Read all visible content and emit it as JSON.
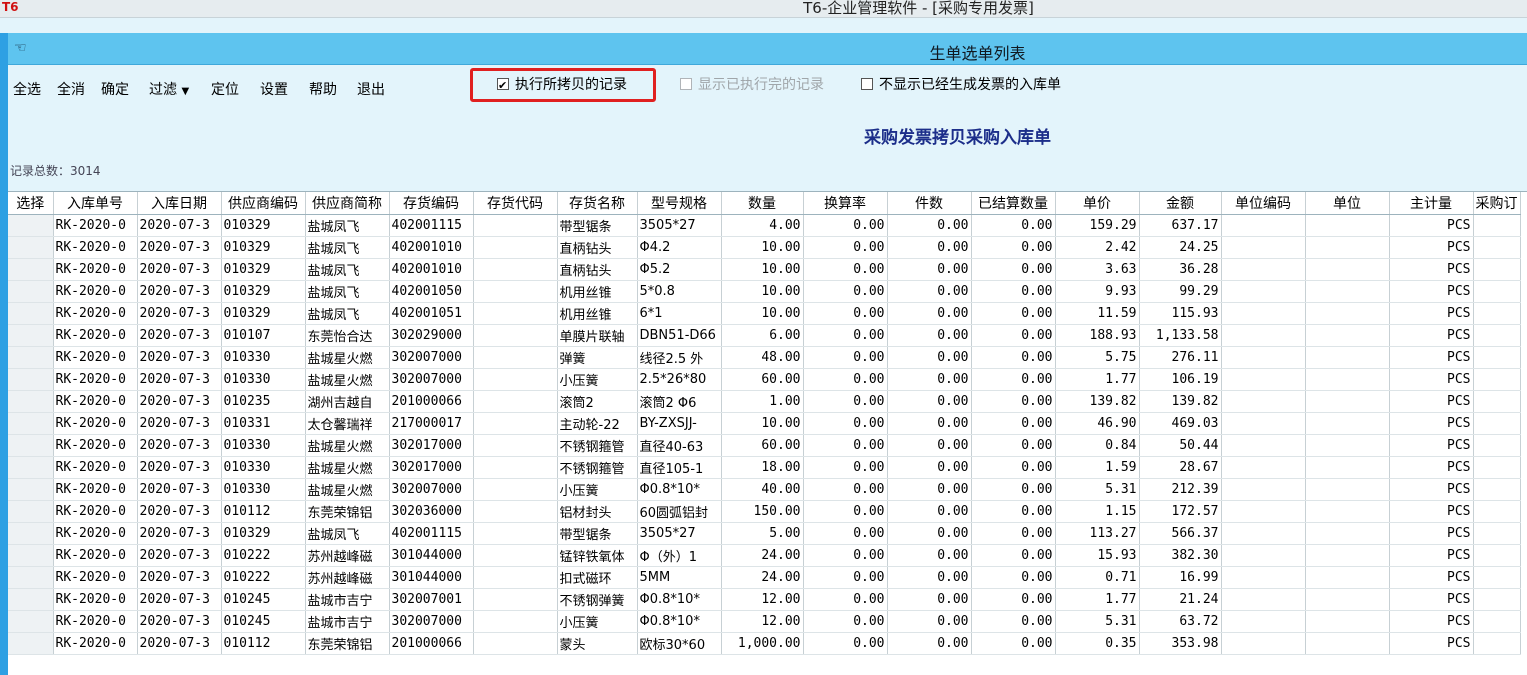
{
  "window": {
    "app_icon": "T6",
    "title": "T6-企业管理软件 - [采购专用发票]"
  },
  "subwindow": {
    "pointer_icon": "hand-pointer-icon",
    "title": "生单选单列表"
  },
  "toolbar": {
    "select_all": "全选",
    "deselect_all": "全消",
    "confirm": "确定",
    "filter": "过滤",
    "filter_arrow": "▼",
    "locate": "定位",
    "settings": "设置",
    "help": "帮助",
    "exit": "退出"
  },
  "options": {
    "exec_copied": {
      "label": "执行所拷贝的记录",
      "checked": true
    },
    "show_executed": {
      "label": "显示已执行完的记录",
      "checked": false,
      "disabled": true
    },
    "hide_invoiced": {
      "label": "不显示已经生成发票的入库单",
      "checked": false
    }
  },
  "heading": "采购发票拷贝采购入库单",
  "record_count": "记录总数：3014",
  "grid": {
    "columns": [
      "选择",
      "入库单号",
      "入库日期",
      "供应商编码",
      "供应商简称",
      "存货编码",
      "存货代码",
      "存货名称",
      "型号规格",
      "数量",
      "换算率",
      "件数",
      "已结算数量",
      "单价",
      "金额",
      "单位编码",
      "单位",
      "主计量",
      "采购订"
    ],
    "rows": [
      [
        "",
        "RK-2020-0",
        "2020-07-3",
        "010329",
        "盐城凤飞",
        "402001115",
        "",
        "带型锯条",
        "3505*27",
        "4.00",
        "0.00",
        "0.00",
        "0.00",
        "159.29",
        "637.17",
        "",
        "",
        "PCS",
        ""
      ],
      [
        "",
        "RK-2020-0",
        "2020-07-3",
        "010329",
        "盐城凤飞",
        "402001010",
        "",
        "直柄钻头",
        "Φ4.2",
        "10.00",
        "0.00",
        "0.00",
        "0.00",
        "2.42",
        "24.25",
        "",
        "",
        "PCS",
        ""
      ],
      [
        "",
        "RK-2020-0",
        "2020-07-3",
        "010329",
        "盐城凤飞",
        "402001010",
        "",
        "直柄钻头",
        "Φ5.2",
        "10.00",
        "0.00",
        "0.00",
        "0.00",
        "3.63",
        "36.28",
        "",
        "",
        "PCS",
        ""
      ],
      [
        "",
        "RK-2020-0",
        "2020-07-3",
        "010329",
        "盐城凤飞",
        "402001050",
        "",
        "机用丝锥",
        "5*0.8",
        "10.00",
        "0.00",
        "0.00",
        "0.00",
        "9.93",
        "99.29",
        "",
        "",
        "PCS",
        ""
      ],
      [
        "",
        "RK-2020-0",
        "2020-07-3",
        "010329",
        "盐城凤飞",
        "402001051",
        "",
        "机用丝锥",
        "6*1",
        "10.00",
        "0.00",
        "0.00",
        "0.00",
        "11.59",
        "115.93",
        "",
        "",
        "PCS",
        ""
      ],
      [
        "",
        "RK-2020-0",
        "2020-07-3",
        "010107",
        "东莞怡合达",
        "302029000",
        "",
        "单膜片联轴",
        "DBN51-D66",
        "6.00",
        "0.00",
        "0.00",
        "0.00",
        "188.93",
        "1,133.58",
        "",
        "",
        "PCS",
        ""
      ],
      [
        "",
        "RK-2020-0",
        "2020-07-3",
        "010330",
        "盐城星火燃",
        "302007000",
        "",
        "弹簧",
        "线径2.5 外",
        "48.00",
        "0.00",
        "0.00",
        "0.00",
        "5.75",
        "276.11",
        "",
        "",
        "PCS",
        ""
      ],
      [
        "",
        "RK-2020-0",
        "2020-07-3",
        "010330",
        "盐城星火燃",
        "302007000",
        "",
        "小压簧",
        "2.5*26*80",
        "60.00",
        "0.00",
        "0.00",
        "0.00",
        "1.77",
        "106.19",
        "",
        "",
        "PCS",
        ""
      ],
      [
        "",
        "RK-2020-0",
        "2020-07-3",
        "010235",
        "湖州吉越自",
        "201000066",
        "",
        "滚筒2",
        "滚筒2 Φ6",
        "1.00",
        "0.00",
        "0.00",
        "0.00",
        "139.82",
        "139.82",
        "",
        "",
        "PCS",
        ""
      ],
      [
        "",
        "RK-2020-0",
        "2020-07-3",
        "010331",
        "太仓馨瑞祥",
        "217000017",
        "",
        "主动轮-22",
        "BY-ZXSJJ-",
        "10.00",
        "0.00",
        "0.00",
        "0.00",
        "46.90",
        "469.03",
        "",
        "",
        "PCS",
        ""
      ],
      [
        "",
        "RK-2020-0",
        "2020-07-3",
        "010330",
        "盐城星火燃",
        "302017000",
        "",
        "不锈钢箍管",
        "直径40-63",
        "60.00",
        "0.00",
        "0.00",
        "0.00",
        "0.84",
        "50.44",
        "",
        "",
        "PCS",
        ""
      ],
      [
        "",
        "RK-2020-0",
        "2020-07-3",
        "010330",
        "盐城星火燃",
        "302017000",
        "",
        "不锈钢箍管",
        "直径105-1",
        "18.00",
        "0.00",
        "0.00",
        "0.00",
        "1.59",
        "28.67",
        "",
        "",
        "PCS",
        ""
      ],
      [
        "",
        "RK-2020-0",
        "2020-07-3",
        "010330",
        "盐城星火燃",
        "302007000",
        "",
        "小压簧",
        "Φ0.8*10*",
        "40.00",
        "0.00",
        "0.00",
        "0.00",
        "5.31",
        "212.39",
        "",
        "",
        "PCS",
        ""
      ],
      [
        "",
        "RK-2020-0",
        "2020-07-3",
        "010112",
        "东莞荣锦铝",
        "302036000",
        "",
        "铝材封头",
        "60圆弧铝封",
        "150.00",
        "0.00",
        "0.00",
        "0.00",
        "1.15",
        "172.57",
        "",
        "",
        "PCS",
        ""
      ],
      [
        "",
        "RK-2020-0",
        "2020-07-3",
        "010329",
        "盐城凤飞",
        "402001115",
        "",
        "带型锯条",
        "3505*27",
        "5.00",
        "0.00",
        "0.00",
        "0.00",
        "113.27",
        "566.37",
        "",
        "",
        "PCS",
        ""
      ],
      [
        "",
        "RK-2020-0",
        "2020-07-3",
        "010222",
        "苏州越峰磁",
        "301044000",
        "",
        "锰锌铁氧体",
        "Φ（外）1",
        "24.00",
        "0.00",
        "0.00",
        "0.00",
        "15.93",
        "382.30",
        "",
        "",
        "PCS",
        ""
      ],
      [
        "",
        "RK-2020-0",
        "2020-07-3",
        "010222",
        "苏州越峰磁",
        "301044000",
        "",
        "扣式磁环",
        "5MM",
        "24.00",
        "0.00",
        "0.00",
        "0.00",
        "0.71",
        "16.99",
        "",
        "",
        "PCS",
        ""
      ],
      [
        "",
        "RK-2020-0",
        "2020-07-3",
        "010245",
        "盐城市吉宁",
        "302007001",
        "",
        "不锈钢弹簧",
        "Φ0.8*10*",
        "12.00",
        "0.00",
        "0.00",
        "0.00",
        "1.77",
        "21.24",
        "",
        "",
        "PCS",
        ""
      ],
      [
        "",
        "RK-2020-0",
        "2020-07-3",
        "010245",
        "盐城市吉宁",
        "302007000",
        "",
        "小压簧",
        "Φ0.8*10*",
        "12.00",
        "0.00",
        "0.00",
        "0.00",
        "5.31",
        "63.72",
        "",
        "",
        "PCS",
        ""
      ],
      [
        "",
        "RK-2020-0",
        "2020-07-3",
        "010112",
        "东莞荣锦铝",
        "201000066",
        "",
        "蒙头",
        "欧标30*60",
        "1,000.00",
        "0.00",
        "0.00",
        "0.00",
        "0.35",
        "353.98",
        "",
        "",
        "PCS",
        ""
      ]
    ]
  }
}
